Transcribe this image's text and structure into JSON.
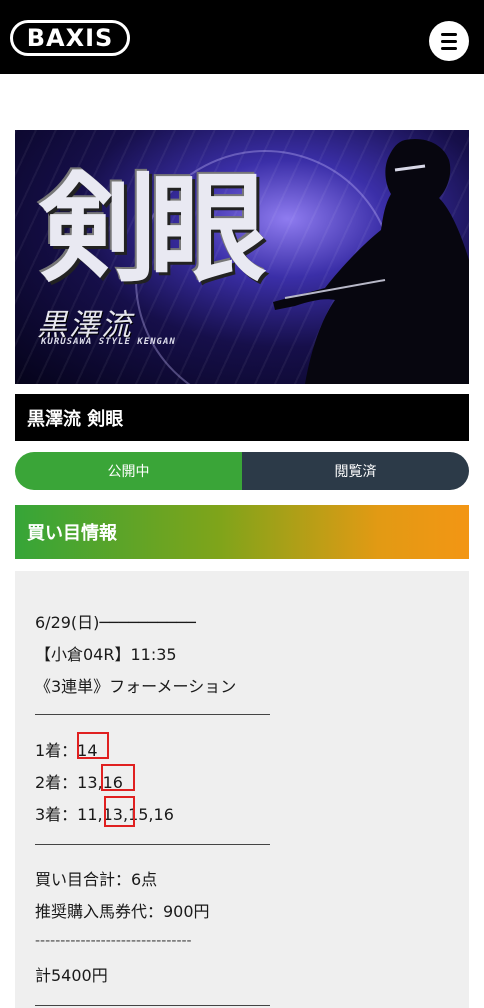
{
  "header": {
    "logo": "BAXIS",
    "menu_icon": "hamburger-menu-icon"
  },
  "banner": {
    "big_text": "剣眼",
    "sub_text": "黒澤流",
    "en_text": "KURUSAWA STYLE KENGAN"
  },
  "post": {
    "title": "黒澤流 剣眼",
    "status_left": "公開中",
    "status_right": "閲覧済"
  },
  "section": {
    "heading": "買い目情報"
  },
  "body": {
    "date": "6/29(日)",
    "date_rule": "──────────",
    "race": "【小倉04R】11:35",
    "bet_type": "《3連単》フォーメーション",
    "first": "1着：14",
    "second": "2着：13,16",
    "third": "3着：11,13,15,16",
    "total_points": "買い目合計：6点",
    "recommended": "推奨購入馬券代：900円",
    "dashes": "-------------------------------",
    "total_cost": "計5400円"
  },
  "colors": {
    "green": "#3aa538",
    "dark": "#2c3a48",
    "highlight": "#e02020",
    "orange": "#f39614"
  }
}
